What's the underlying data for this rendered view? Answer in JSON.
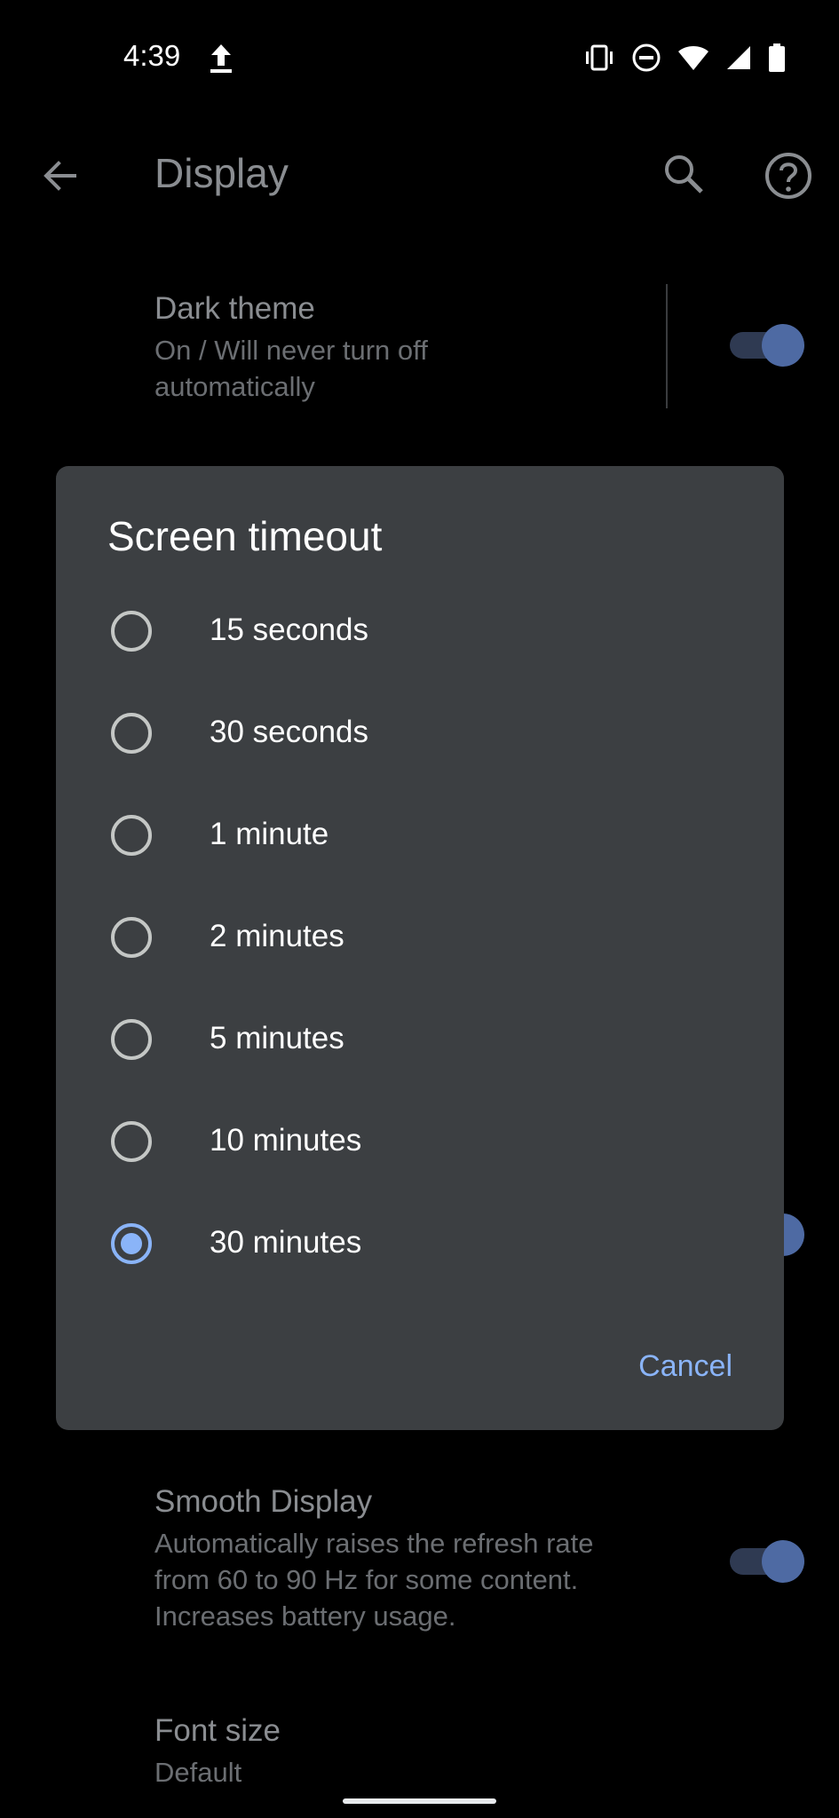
{
  "status_bar": {
    "time": "4:39"
  },
  "app_bar": {
    "title": "Display"
  },
  "background": {
    "dark_theme": {
      "title": "Dark theme",
      "summary": "On / Will never turn off automatically"
    },
    "smooth_display": {
      "title": "Smooth Display",
      "summary": "Automatically raises the refresh rate from 60 to 90 Hz for some content. Increases battery usage."
    },
    "font_size": {
      "title": "Font size",
      "summary": "Default"
    }
  },
  "dialog": {
    "title": "Screen timeout",
    "options": [
      {
        "label": "15 seconds",
        "selected": false
      },
      {
        "label": "30 seconds",
        "selected": false
      },
      {
        "label": "1 minute",
        "selected": false
      },
      {
        "label": "2 minutes",
        "selected": false
      },
      {
        "label": "5 minutes",
        "selected": false
      },
      {
        "label": "10 minutes",
        "selected": false
      },
      {
        "label": "30 minutes",
        "selected": true
      }
    ],
    "cancel_label": "Cancel"
  },
  "colors": {
    "accent": "#8ab4f8",
    "dialog_bg": "#3c3f42",
    "background": "#000000"
  }
}
